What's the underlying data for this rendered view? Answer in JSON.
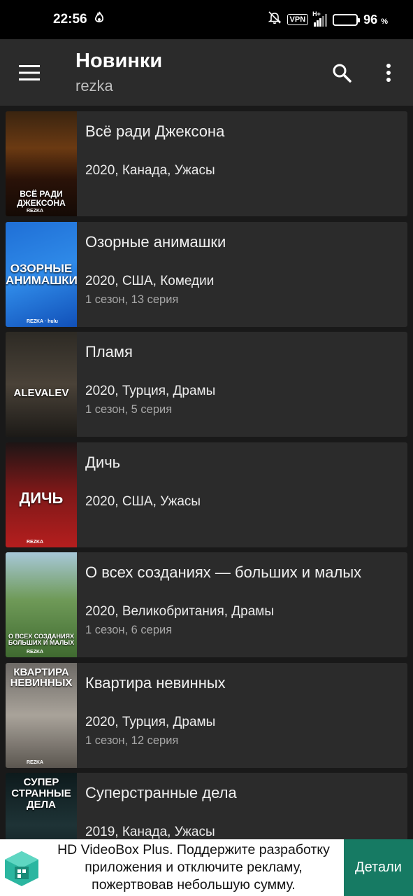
{
  "status": {
    "time": "22:56",
    "vpn": "VPN",
    "network": "H+",
    "battery": "96",
    "battery_unit": "%",
    "battery_level": 0.96
  },
  "appbar": {
    "title": "Новинки",
    "subtitle": "rezka",
    "menu_icon": "menu-icon",
    "search_icon": "search-icon",
    "more_icon": "more-vert-icon"
  },
  "items": [
    {
      "title": "Всё ради Джексона",
      "meta": "2020, Канада, Ужасы",
      "episode": "",
      "poster_text": "ВСЁ РАДИ ДЖЕКСОНА",
      "poster_badge": "REZKA",
      "poster_bg": "linear-gradient(180deg,#3a2410 0%,#6b3a12 35%,#2a1208 65%,#140a05 100%)"
    },
    {
      "title": "Озорные анимашки",
      "meta": "2020, США, Комедии",
      "episode": "1 сезон, 13 серия",
      "poster_text": "ОЗОРНЫЕ АНИМАШКИ",
      "poster_badge": "REZKA · hulu",
      "poster_bg": "linear-gradient(160deg,#1f6fd6 0%,#2f8ae8 50%,#1150b8 100%)"
    },
    {
      "title": "Пламя",
      "meta": "2020, Турция, Драмы",
      "episode": "1 сезон, 5 серия",
      "poster_text": "ALEVALEV",
      "poster_badge": "",
      "poster_bg": "linear-gradient(180deg,#2d2a24 0%,#4a4238 50%,#1c1a17 100%)"
    },
    {
      "title": "Дичь",
      "meta": "2020, США, Ужасы",
      "episode": "",
      "poster_text": "ДИЧЬ",
      "poster_badge": "REZKA",
      "poster_bg": "linear-gradient(180deg,#1d1515 0%,#7a1818 45%,#b51e1e 100%)"
    },
    {
      "title": "О всех созданиях — больших и малых",
      "meta": "2020, Великобритания, Драмы",
      "episode": "1 сезон, 6 серия",
      "poster_text": "О ВСЕХ СОЗДАНИЯХ БОЛЬШИХ И МАЛЫХ",
      "poster_badge": "REZKA",
      "poster_bg": "linear-gradient(180deg,#a7c8d8 0%,#6f9a58 45%,#3f6a30 100%)"
    },
    {
      "title": "Квартира невинных",
      "meta": "2020, Турция, Драмы",
      "episode": "1 сезон, 12 серия",
      "poster_text": "КВАРТИРА НЕВИННЫХ",
      "poster_badge": "REZKA",
      "poster_bg": "linear-gradient(180deg,#6d6a66 0%,#a9a39a 50%,#5b5650 100%)"
    },
    {
      "title": "Суперстранные дела",
      "meta": "2019, Канада, Ужасы",
      "episode": "",
      "poster_text": "СУПЕР СТРАННЫЕ ДЕЛА",
      "poster_badge": "",
      "poster_bg": "linear-gradient(180deg,#0d1a1c 0%,#1e3336 50%,#0a1213 100%)"
    }
  ],
  "ad": {
    "text": "HD VideoBox Plus. Поддержите разработку приложения и отключите рекламу, пожертвовав небольшую сумму.",
    "button": "Детали",
    "logo_icon": "videobox-logo-icon"
  }
}
